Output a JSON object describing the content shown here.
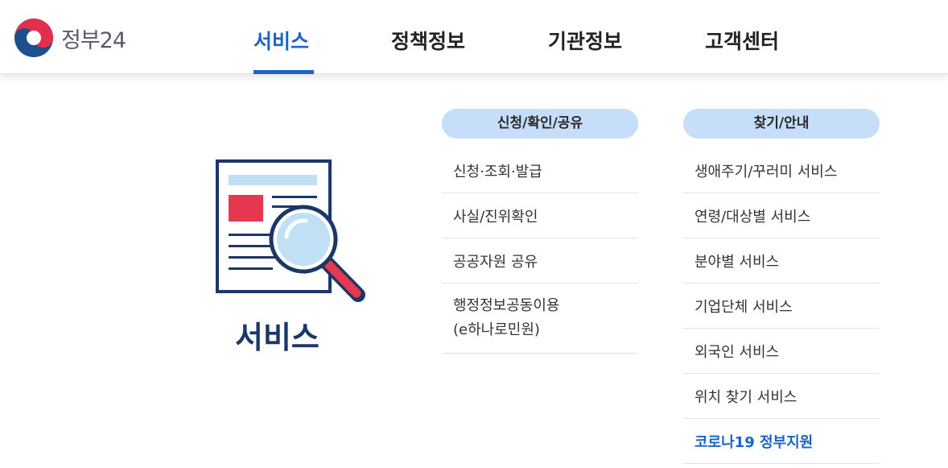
{
  "header": {
    "logo_text": "정부24",
    "nav": [
      {
        "label": "서비스",
        "active": true
      },
      {
        "label": "정책정보",
        "active": false
      },
      {
        "label": "기관정보",
        "active": false
      },
      {
        "label": "고객센터",
        "active": false
      }
    ]
  },
  "hero": {
    "title": "서비스"
  },
  "columns": [
    {
      "heading": "신청/확인/공유",
      "items": [
        "신청·조회·발급",
        "사실/진위확인",
        "공공자원 공유",
        "행정정보공동이용",
        "(e하나로민원)"
      ]
    },
    {
      "heading": "찾기/안내",
      "items": [
        "생애주기/꾸러미 서비스",
        "연령/대상별 서비스",
        "분야별 서비스",
        "기업단체 서비스",
        "외국인 서비스",
        "위치 찾기 서비스",
        "코로나19 정부지원"
      ]
    }
  ],
  "colors": {
    "accent": "#1a64c8",
    "pill": "#c6def9",
    "hero_title": "#1b3768",
    "doc_red": "#e63950"
  }
}
